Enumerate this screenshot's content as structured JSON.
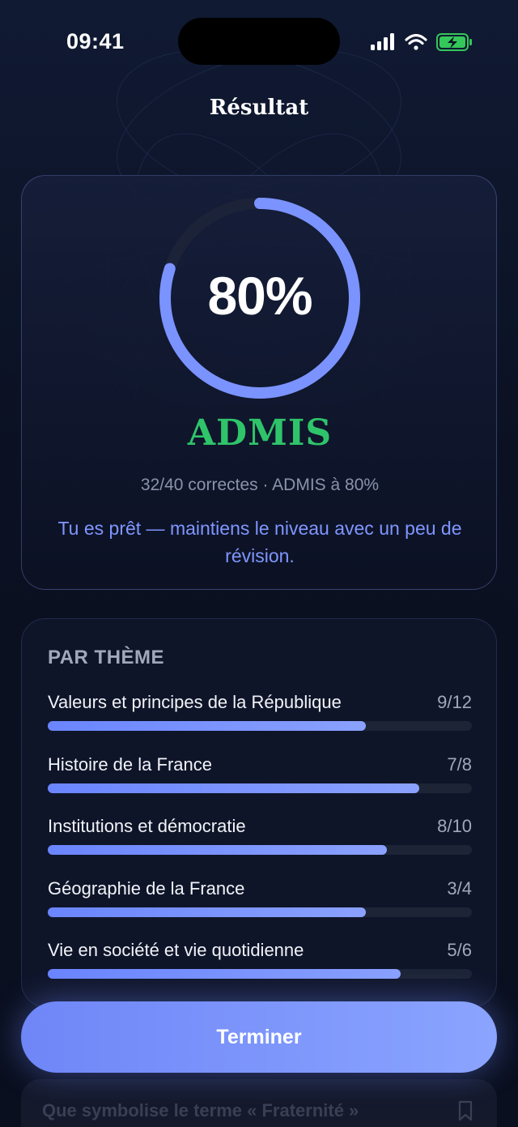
{
  "status_bar": {
    "time": "09:41",
    "icons": [
      "signal-icon",
      "wifi-icon",
      "battery-charging-icon"
    ]
  },
  "header": {
    "title": "Résultat"
  },
  "score": {
    "percent_label": "80%",
    "progress": 0.8,
    "verdict": "ADMIS",
    "summary": "32/40 correctes · ADMIS à 80%",
    "advice": "Tu es prêt — maintiens le niveau avec un peu de révision."
  },
  "themes": {
    "heading": "PAR THÈME",
    "items": [
      {
        "label": "Valeurs et principes de la République",
        "score": "9/12",
        "ratio": 0.75
      },
      {
        "label": "Histoire de la France",
        "score": "7/8",
        "ratio": 0.875
      },
      {
        "label": "Institutions et démocratie",
        "score": "8/10",
        "ratio": 0.8
      },
      {
        "label": "Géographie de la France",
        "score": "3/4",
        "ratio": 0.75
      },
      {
        "label": "Vie en société et vie quotidienne",
        "score": "5/6",
        "ratio": 0.833
      }
    ]
  },
  "action": {
    "finish_label": "Terminer"
  },
  "peek": {
    "question": "Que symbolise le terme « Fraternité »"
  },
  "colors": {
    "accent": "#7b93ff",
    "success": "#2fc46a",
    "background": "#0c1224",
    "muted": "#8a93ab"
  }
}
